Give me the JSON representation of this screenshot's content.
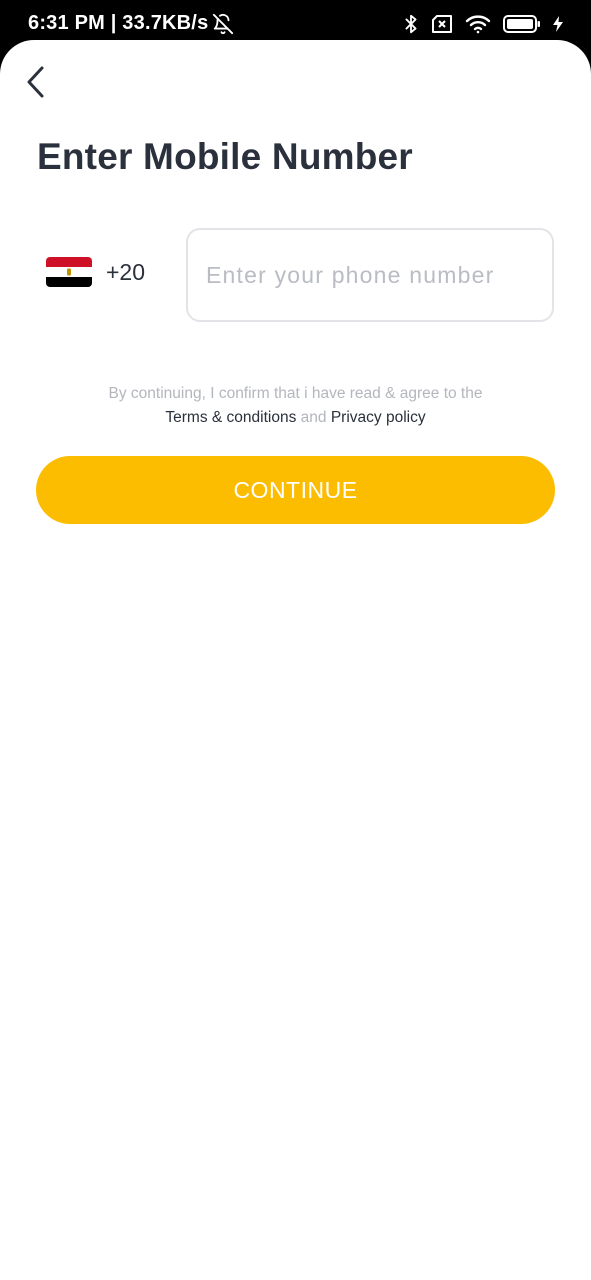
{
  "status_bar": {
    "time_speed": "6:31 PM | 33.7KB/s",
    "icons": [
      "bell-off-icon",
      "bluetooth-icon",
      "no-sim-icon",
      "wifi-icon",
      "battery-icon",
      "charging-icon"
    ]
  },
  "header": {
    "title": "Enter Mobile Number",
    "back_icon": "chevron-left-icon"
  },
  "phone": {
    "country_flag": "egypt-flag-icon",
    "country_code": "+20",
    "placeholder": "Enter your phone number",
    "value": ""
  },
  "consent": {
    "line1": "By continuing, I confirm that i have read & agree to the",
    "terms_label": "Terms & conditions",
    "and_text": "and",
    "privacy_label": "Privacy policy"
  },
  "continue_button": {
    "label": "CONTINUE"
  },
  "colors": {
    "accent": "#fcbc00",
    "title_text": "#2a313c",
    "muted_text": "#b3b6bc",
    "input_border": "#e3e4e8"
  }
}
